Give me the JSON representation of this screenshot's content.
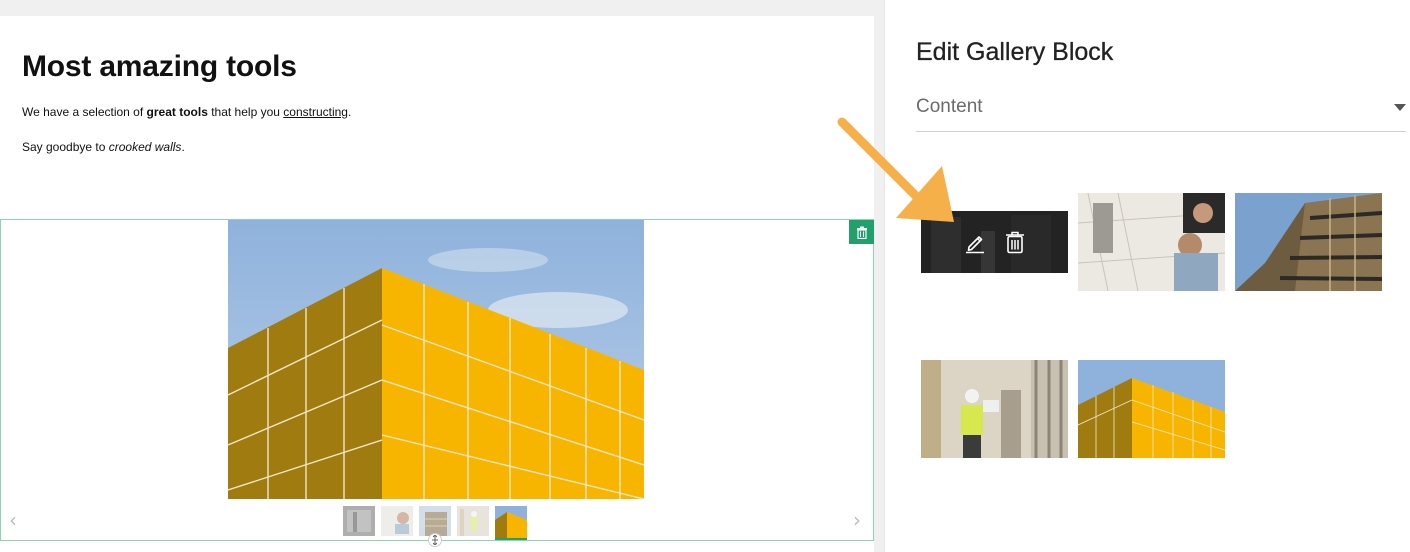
{
  "editor": {
    "page_title": "Most amazing tools",
    "paragraph1": {
      "before": "We have a selection of ",
      "bold": "great tools",
      "middle": " that help you ",
      "link": "constructing",
      "after": "."
    },
    "paragraph2": {
      "before": "Say goodbye to ",
      "italic": "crooked walls",
      "after": "."
    },
    "gallery": {
      "prev_arrow": "‹",
      "next_arrow": "›",
      "thumbnail_count": 5,
      "active_thumbnail": 5
    }
  },
  "panel": {
    "title": "Edit Gallery Block",
    "section": "Content"
  },
  "images": [
    {
      "name": "workshop-tools",
      "icon": "pencil-icon/trash-icon overlay shown"
    },
    {
      "name": "blueprint-planning"
    },
    {
      "name": "apartment-facade"
    },
    {
      "name": "warehouse-worker"
    },
    {
      "name": "yellow-building"
    }
  ],
  "colors": {
    "accent_green": "#21a06b",
    "gallery_border": "#8fd3b5",
    "highlight_arrow": "#f5b04a",
    "building_yellow": "#f7b500",
    "sky_blue": "#8fb2dc"
  }
}
